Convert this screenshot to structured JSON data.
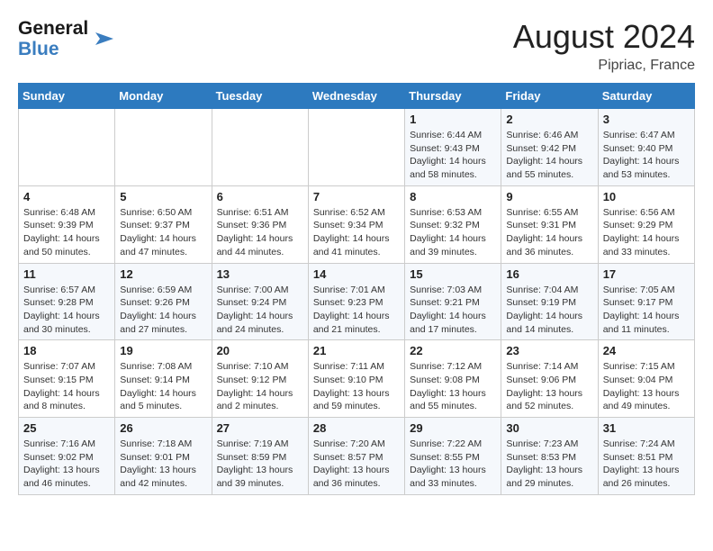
{
  "header": {
    "logo_line1": "General",
    "logo_line2": "Blue",
    "month": "August 2024",
    "location": "Pipriac, France"
  },
  "weekdays": [
    "Sunday",
    "Monday",
    "Tuesday",
    "Wednesday",
    "Thursday",
    "Friday",
    "Saturday"
  ],
  "weeks": [
    [
      {
        "day": "",
        "info": ""
      },
      {
        "day": "",
        "info": ""
      },
      {
        "day": "",
        "info": ""
      },
      {
        "day": "",
        "info": ""
      },
      {
        "day": "1",
        "info": "Sunrise: 6:44 AM\nSunset: 9:43 PM\nDaylight: 14 hours\nand 58 minutes."
      },
      {
        "day": "2",
        "info": "Sunrise: 6:46 AM\nSunset: 9:42 PM\nDaylight: 14 hours\nand 55 minutes."
      },
      {
        "day": "3",
        "info": "Sunrise: 6:47 AM\nSunset: 9:40 PM\nDaylight: 14 hours\nand 53 minutes."
      }
    ],
    [
      {
        "day": "4",
        "info": "Sunrise: 6:48 AM\nSunset: 9:39 PM\nDaylight: 14 hours\nand 50 minutes."
      },
      {
        "day": "5",
        "info": "Sunrise: 6:50 AM\nSunset: 9:37 PM\nDaylight: 14 hours\nand 47 minutes."
      },
      {
        "day": "6",
        "info": "Sunrise: 6:51 AM\nSunset: 9:36 PM\nDaylight: 14 hours\nand 44 minutes."
      },
      {
        "day": "7",
        "info": "Sunrise: 6:52 AM\nSunset: 9:34 PM\nDaylight: 14 hours\nand 41 minutes."
      },
      {
        "day": "8",
        "info": "Sunrise: 6:53 AM\nSunset: 9:32 PM\nDaylight: 14 hours\nand 39 minutes."
      },
      {
        "day": "9",
        "info": "Sunrise: 6:55 AM\nSunset: 9:31 PM\nDaylight: 14 hours\nand 36 minutes."
      },
      {
        "day": "10",
        "info": "Sunrise: 6:56 AM\nSunset: 9:29 PM\nDaylight: 14 hours\nand 33 minutes."
      }
    ],
    [
      {
        "day": "11",
        "info": "Sunrise: 6:57 AM\nSunset: 9:28 PM\nDaylight: 14 hours\nand 30 minutes."
      },
      {
        "day": "12",
        "info": "Sunrise: 6:59 AM\nSunset: 9:26 PM\nDaylight: 14 hours\nand 27 minutes."
      },
      {
        "day": "13",
        "info": "Sunrise: 7:00 AM\nSunset: 9:24 PM\nDaylight: 14 hours\nand 24 minutes."
      },
      {
        "day": "14",
        "info": "Sunrise: 7:01 AM\nSunset: 9:23 PM\nDaylight: 14 hours\nand 21 minutes."
      },
      {
        "day": "15",
        "info": "Sunrise: 7:03 AM\nSunset: 9:21 PM\nDaylight: 14 hours\nand 17 minutes."
      },
      {
        "day": "16",
        "info": "Sunrise: 7:04 AM\nSunset: 9:19 PM\nDaylight: 14 hours\nand 14 minutes."
      },
      {
        "day": "17",
        "info": "Sunrise: 7:05 AM\nSunset: 9:17 PM\nDaylight: 14 hours\nand 11 minutes."
      }
    ],
    [
      {
        "day": "18",
        "info": "Sunrise: 7:07 AM\nSunset: 9:15 PM\nDaylight: 14 hours\nand 8 minutes."
      },
      {
        "day": "19",
        "info": "Sunrise: 7:08 AM\nSunset: 9:14 PM\nDaylight: 14 hours\nand 5 minutes."
      },
      {
        "day": "20",
        "info": "Sunrise: 7:10 AM\nSunset: 9:12 PM\nDaylight: 14 hours\nand 2 minutes."
      },
      {
        "day": "21",
        "info": "Sunrise: 7:11 AM\nSunset: 9:10 PM\nDaylight: 13 hours\nand 59 minutes."
      },
      {
        "day": "22",
        "info": "Sunrise: 7:12 AM\nSunset: 9:08 PM\nDaylight: 13 hours\nand 55 minutes."
      },
      {
        "day": "23",
        "info": "Sunrise: 7:14 AM\nSunset: 9:06 PM\nDaylight: 13 hours\nand 52 minutes."
      },
      {
        "day": "24",
        "info": "Sunrise: 7:15 AM\nSunset: 9:04 PM\nDaylight: 13 hours\nand 49 minutes."
      }
    ],
    [
      {
        "day": "25",
        "info": "Sunrise: 7:16 AM\nSunset: 9:02 PM\nDaylight: 13 hours\nand 46 minutes."
      },
      {
        "day": "26",
        "info": "Sunrise: 7:18 AM\nSunset: 9:01 PM\nDaylight: 13 hours\nand 42 minutes."
      },
      {
        "day": "27",
        "info": "Sunrise: 7:19 AM\nSunset: 8:59 PM\nDaylight: 13 hours\nand 39 minutes."
      },
      {
        "day": "28",
        "info": "Sunrise: 7:20 AM\nSunset: 8:57 PM\nDaylight: 13 hours\nand 36 minutes."
      },
      {
        "day": "29",
        "info": "Sunrise: 7:22 AM\nSunset: 8:55 PM\nDaylight: 13 hours\nand 33 minutes."
      },
      {
        "day": "30",
        "info": "Sunrise: 7:23 AM\nSunset: 8:53 PM\nDaylight: 13 hours\nand 29 minutes."
      },
      {
        "day": "31",
        "info": "Sunrise: 7:24 AM\nSunset: 8:51 PM\nDaylight: 13 hours\nand 26 minutes."
      }
    ]
  ]
}
